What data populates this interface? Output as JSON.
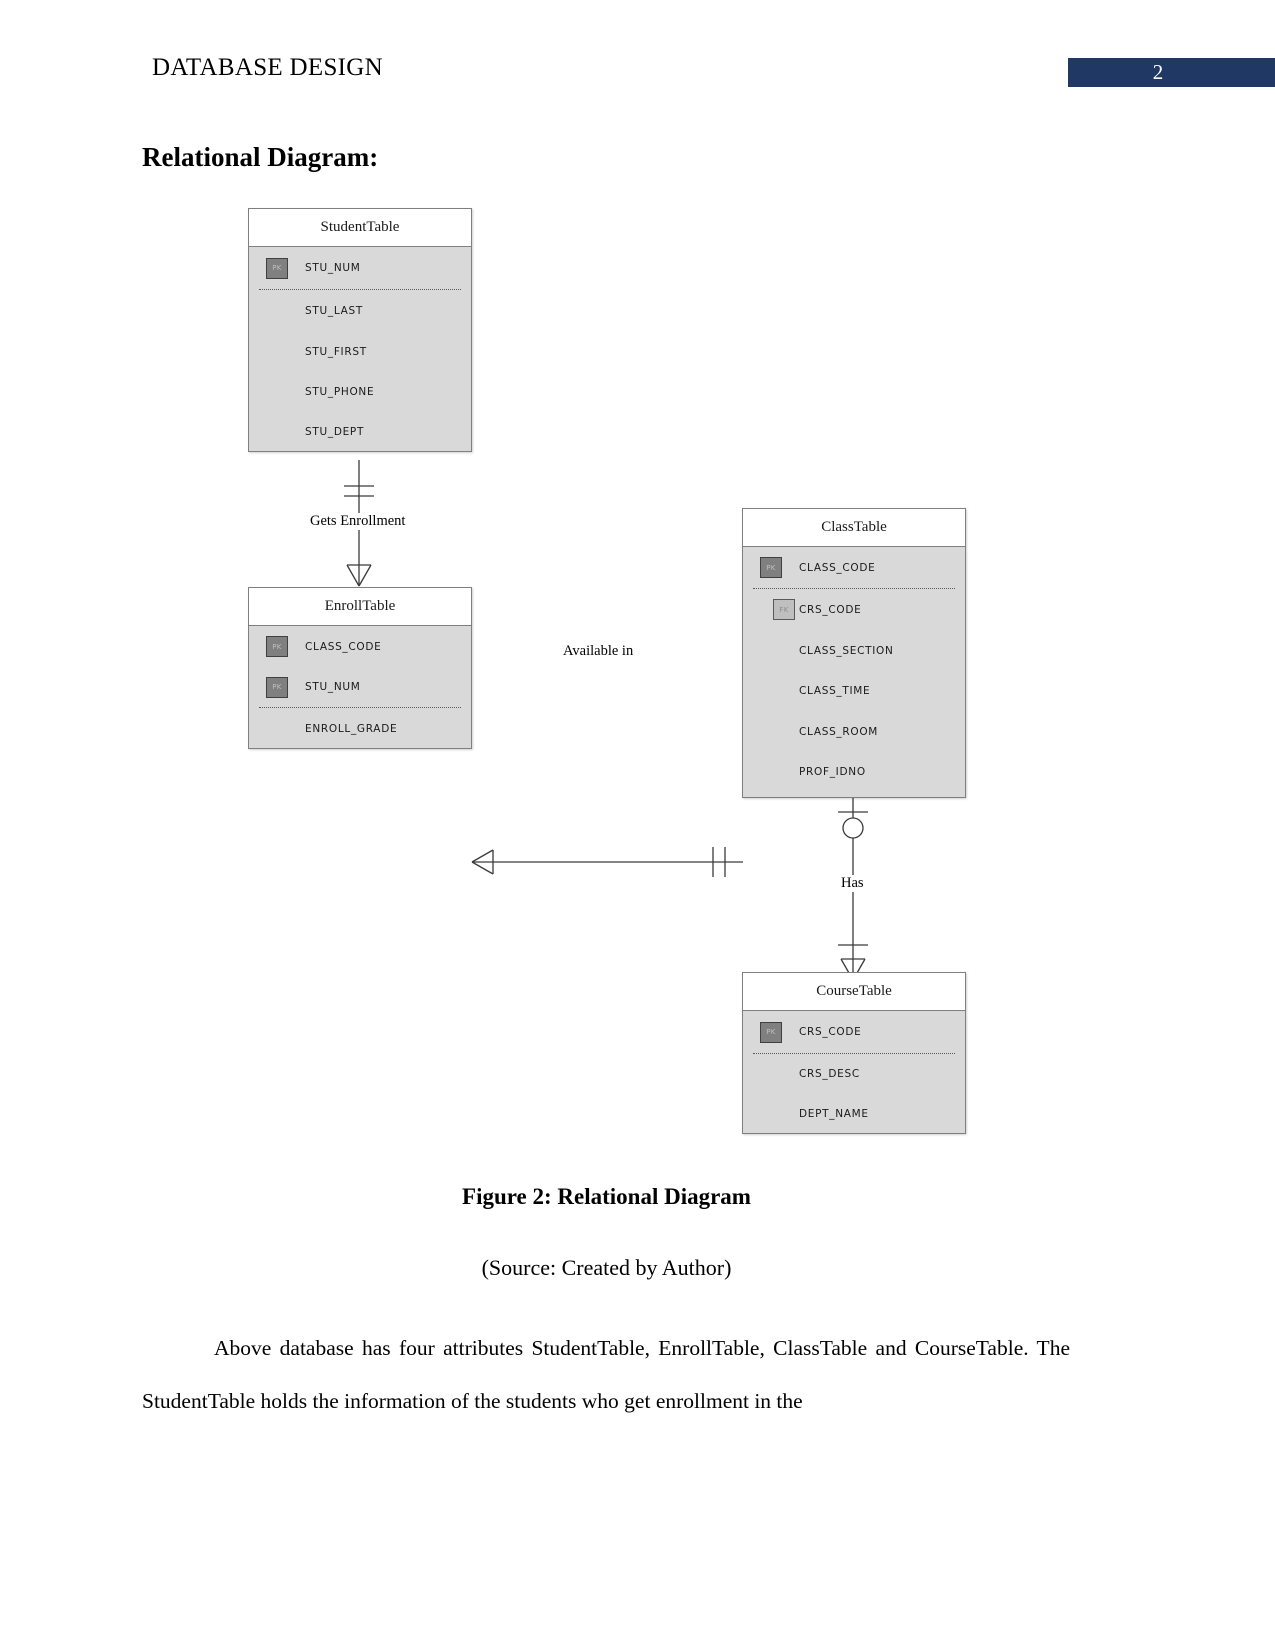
{
  "header": {
    "title": "DATABASE DESIGN",
    "page_number": "2",
    "badge_color": "#1f3864"
  },
  "section": {
    "heading": "Relational Diagram:"
  },
  "diagram": {
    "entities": [
      {
        "id": "student-table",
        "name": "StudentTable",
        "fields": [
          {
            "name": "STU_NUM",
            "key": "PK"
          },
          {
            "name": "STU_LAST",
            "key": ""
          },
          {
            "name": "STU_FIRST",
            "key": ""
          },
          {
            "name": "STU_PHONE",
            "key": ""
          },
          {
            "name": "STU_DEPT",
            "key": ""
          }
        ]
      },
      {
        "id": "enroll-table",
        "name": "EnrollTable",
        "fields": [
          {
            "name": "CLASS_CODE",
            "key": "PK"
          },
          {
            "name": "STU_NUM",
            "key": "PK"
          },
          {
            "name": "ENROLL_GRADE",
            "key": ""
          }
        ]
      },
      {
        "id": "class-table",
        "name": "ClassTable",
        "fields": [
          {
            "name": "CLASS_CODE",
            "key": "PK"
          },
          {
            "name": "CRS_CODE",
            "key": "FK"
          },
          {
            "name": "CLASS_SECTION",
            "key": ""
          },
          {
            "name": "CLASS_TIME",
            "key": ""
          },
          {
            "name": "CLASS_ROOM",
            "key": ""
          },
          {
            "name": "PROF_IDNO",
            "key": ""
          }
        ]
      },
      {
        "id": "course-table",
        "name": "CourseTable",
        "fields": [
          {
            "name": "CRS_CODE",
            "key": "PK"
          },
          {
            "name": "CRS_DESC",
            "key": ""
          },
          {
            "name": "DEPT_NAME",
            "key": ""
          }
        ]
      }
    ],
    "relationships": [
      {
        "id": "gets-enrollment",
        "label": "Gets Enrollment",
        "from": "StudentTable",
        "to": "EnrollTable"
      },
      {
        "id": "available-in",
        "label": "Available in",
        "from": "EnrollTable",
        "to": "ClassTable"
      },
      {
        "id": "has",
        "label": "Has",
        "from": "ClassTable",
        "to": "CourseTable"
      }
    ],
    "key_badges": {
      "pk": "PK",
      "fk": "FK"
    }
  },
  "figure": {
    "caption": "Figure 2: Relational Diagram",
    "source": "(Source: Created by Author)"
  },
  "body": {
    "paragraph": "Above database has four attributes StudentTable, EnrollTable, ClassTable and CourseTable. The StudentTable holds the information of the students who get enrollment in the"
  }
}
